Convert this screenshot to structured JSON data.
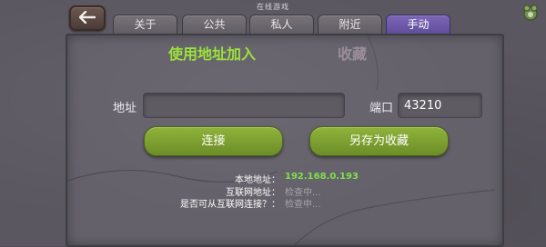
{
  "window": {
    "title": "在线游戏"
  },
  "tabs": [
    {
      "label": "关于"
    },
    {
      "label": "公共"
    },
    {
      "label": "私人"
    },
    {
      "label": "附近"
    },
    {
      "label": "手动"
    }
  ],
  "sections": {
    "join_by_address": "使用地址加入",
    "favorites": "收藏"
  },
  "form": {
    "address_label": "地址",
    "address_value": "",
    "port_label": "端口",
    "port_value": "43210"
  },
  "buttons": {
    "connect": "连接",
    "save_favorite": "另存为收藏"
  },
  "info": {
    "local_label": "本地地址：",
    "local_value": "192.168.0.193",
    "internet_label": "互联网地址：",
    "internet_value": "检查中...",
    "reachable_label": "是否可从互联网连接？：",
    "reachable_value": "检查中..."
  },
  "colors": {
    "active_tab": "#6f5aa9",
    "section_active": "#9be23a",
    "section_inactive": "#9a8f99",
    "button_green": "#7da131",
    "ip_value": "#7fe14a",
    "pending_value": "#a7a3aa"
  },
  "icons": {
    "back": "back-arrow-icon",
    "corner": "badge-icon"
  }
}
